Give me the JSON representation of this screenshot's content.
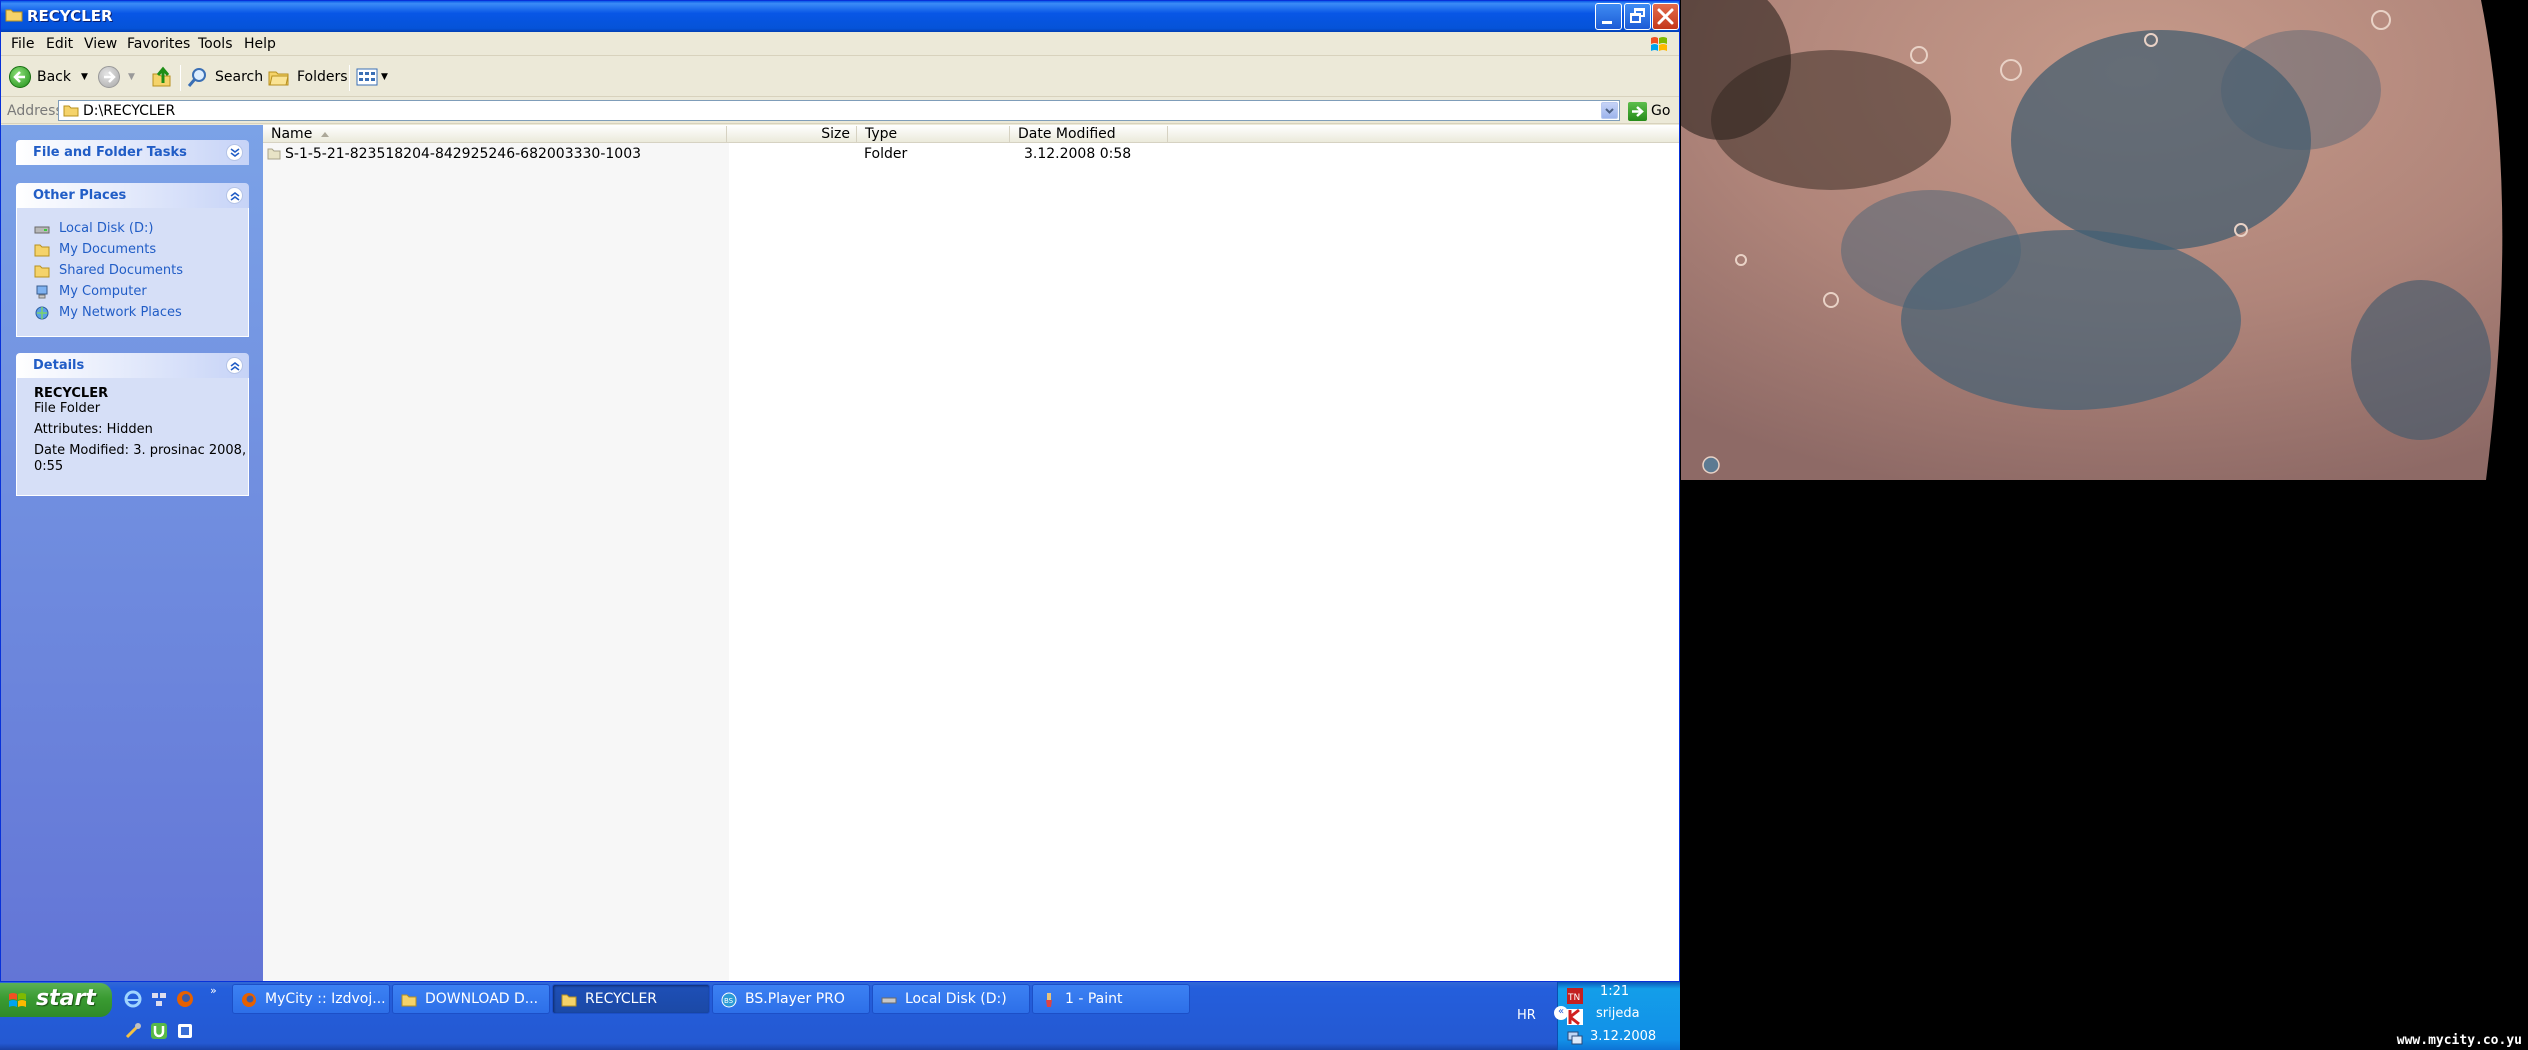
{
  "window": {
    "title": "RECYCLER",
    "menu": [
      "File",
      "Edit",
      "View",
      "Favorites",
      "Tools",
      "Help"
    ],
    "toolbar": {
      "back": "Back",
      "search": "Search",
      "folders": "Folders"
    },
    "address": {
      "label": "Address",
      "value": "D:\\RECYCLER",
      "go": "Go"
    }
  },
  "taskpane": {
    "file_tasks": {
      "title": "File and Folder Tasks"
    },
    "other_places": {
      "title": "Other Places",
      "items": [
        {
          "label": "Local Disk (D:)",
          "icon": "drive-icon"
        },
        {
          "label": "My Documents",
          "icon": "folder-icon"
        },
        {
          "label": "Shared Documents",
          "icon": "folder-icon"
        },
        {
          "label": "My Computer",
          "icon": "computer-icon"
        },
        {
          "label": "My Network Places",
          "icon": "network-icon"
        }
      ]
    },
    "details": {
      "title": "Details",
      "name": "RECYCLER",
      "type": "File Folder",
      "attributes": "Attributes: Hidden",
      "modified_line1": "Date Modified: 3. prosinac 2008,",
      "modified_line2": "0:55"
    }
  },
  "filelist": {
    "columns": {
      "name": "Name",
      "size": "Size",
      "type": "Type",
      "modified": "Date Modified"
    },
    "rows": [
      {
        "name": "S-1-5-21-823518204-842925246-682003330-1003",
        "size": "",
        "type": "Folder",
        "modified": "3.12.2008 0:58"
      }
    ]
  },
  "taskbar": {
    "start": "start",
    "tasks": [
      {
        "label": "MyCity :: Izdvoj...",
        "icon": "firefox-icon"
      },
      {
        "label": "DOWNLOAD D...",
        "icon": "folder-icon"
      },
      {
        "label": "RECYCLER",
        "icon": "folder-icon",
        "active": true
      },
      {
        "label": "BS.Player PRO",
        "icon": "bsplayer-icon"
      },
      {
        "label": "Local Disk (D:)",
        "icon": "drive-icon"
      },
      {
        "label": "1 - Paint",
        "icon": "paint-icon"
      }
    ],
    "tray": {
      "language": "HR",
      "time": "1:21",
      "day": "srijeda",
      "date": "3.12.2008"
    }
  },
  "desktop": {
    "watermark": "www.mycity.co.yu"
  },
  "colors": {
    "titlebar": "#0553D8",
    "taskpane": "#6375D6",
    "link": "#215DC6",
    "taskbar": "#245EDC",
    "start": "#3A9B32"
  }
}
